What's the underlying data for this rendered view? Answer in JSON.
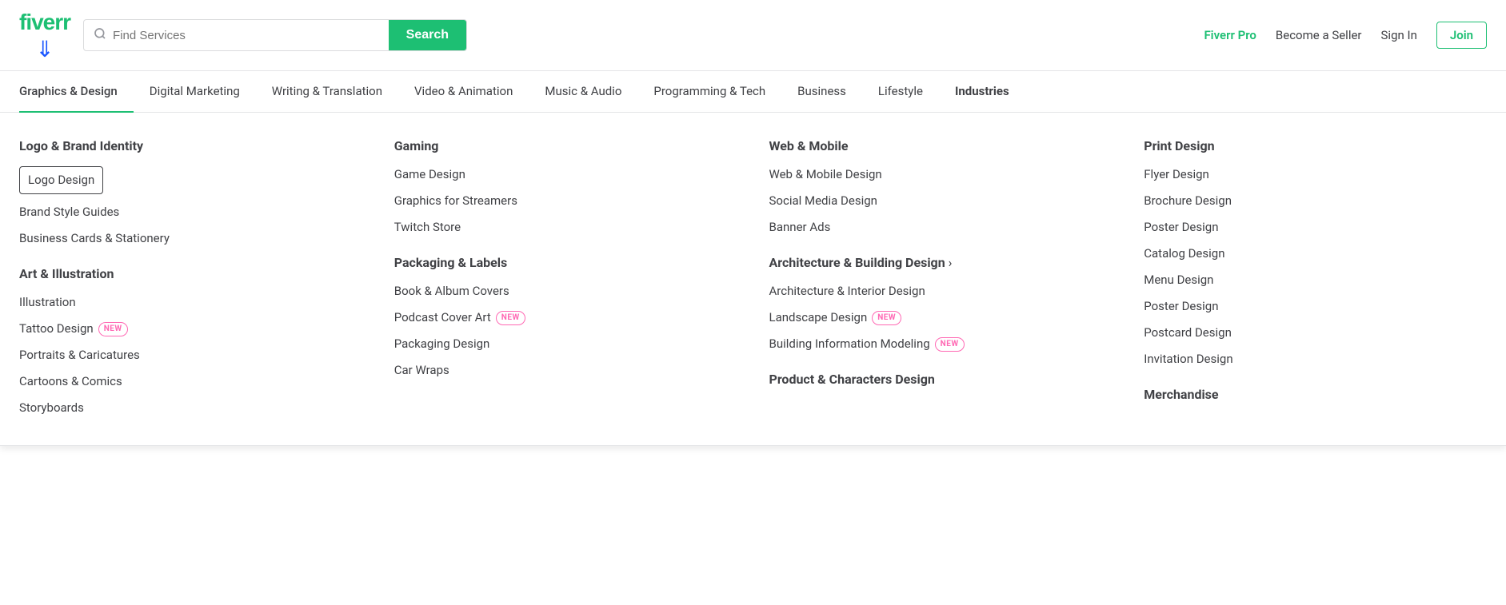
{
  "header": {
    "logo": "fiverr",
    "search": {
      "placeholder": "Find Services",
      "button_label": "Search"
    },
    "nav": {
      "pro": "Fiverr Pro",
      "become_seller": "Become a Seller",
      "sign_in": "Sign In",
      "join": "Join"
    }
  },
  "tabs": [
    {
      "id": "graphics",
      "label": "Graphics & Design",
      "active": true
    },
    {
      "id": "digital",
      "label": "Digital Marketing"
    },
    {
      "id": "writing",
      "label": "Writing & Translation"
    },
    {
      "id": "video",
      "label": "Video & Animation"
    },
    {
      "id": "music",
      "label": "Music & Audio"
    },
    {
      "id": "programming",
      "label": "Programming & Tech"
    },
    {
      "id": "business",
      "label": "Business"
    },
    {
      "id": "lifestyle",
      "label": "Lifestyle"
    },
    {
      "id": "industries",
      "label": "Industries",
      "bold": true
    }
  ],
  "dropdown": {
    "columns": [
      {
        "id": "col1",
        "sections": [
          {
            "title": "Logo & Brand Identity",
            "items": [
              {
                "label": "Logo Design",
                "highlighted": true
              },
              {
                "label": "Brand Style Guides"
              },
              {
                "label": "Business Cards & Stationery"
              }
            ]
          },
          {
            "title": "Art & Illustration",
            "items": [
              {
                "label": "Illustration"
              },
              {
                "label": "Tattoo Design",
                "badge": "NEW"
              },
              {
                "label": "Portraits & Caricatures"
              },
              {
                "label": "Cartoons & Comics"
              },
              {
                "label": "Storyboards"
              }
            ]
          }
        ]
      },
      {
        "id": "col2",
        "sections": [
          {
            "title": "Gaming",
            "items": [
              {
                "label": "Game Design"
              },
              {
                "label": "Graphics for Streamers"
              },
              {
                "label": "Twitch Store"
              }
            ]
          },
          {
            "title": "Packaging & Labels",
            "items": [
              {
                "label": "Book & Album Covers"
              },
              {
                "label": "Podcast Cover Art",
                "badge": "NEW"
              },
              {
                "label": "Packaging Design"
              },
              {
                "label": "Car Wraps"
              }
            ]
          }
        ]
      },
      {
        "id": "col3",
        "sections": [
          {
            "title": "Web & Mobile",
            "items": [
              {
                "label": "Web & Mobile Design"
              },
              {
                "label": "Social Media Design"
              },
              {
                "label": "Banner Ads"
              }
            ]
          },
          {
            "title": "Architecture & Building Design",
            "hasChevron": true,
            "items": [
              {
                "label": "Architecture & Interior Design"
              },
              {
                "label": "Landscape Design",
                "badge": "NEW"
              },
              {
                "label": "Building Information Modeling",
                "badge": "NEW"
              }
            ]
          },
          {
            "title": "Product & Characters Design",
            "items": []
          }
        ]
      },
      {
        "id": "col4",
        "sections": [
          {
            "title": "Print Design",
            "items": [
              {
                "label": "Flyer Design"
              },
              {
                "label": "Brochure Design"
              },
              {
                "label": "Poster Design"
              },
              {
                "label": "Catalog Design"
              },
              {
                "label": "Menu Design"
              },
              {
                "label": "Poster Design"
              },
              {
                "label": "Postcard Design"
              },
              {
                "label": "Invitation Design"
              }
            ]
          },
          {
            "title": "Merchandise",
            "items": []
          }
        ]
      }
    ]
  }
}
